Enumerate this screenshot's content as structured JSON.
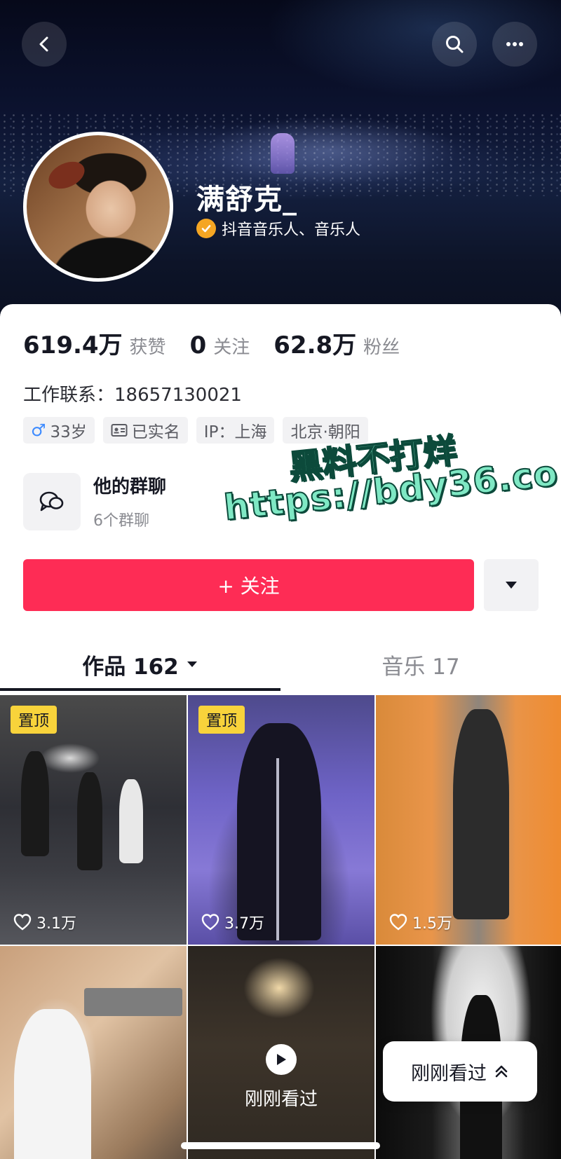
{
  "header": {
    "username": "满舒克_",
    "verification": "抖音音乐人、音乐人",
    "accent_color": "#fe2c55",
    "icons": [
      "back-icon",
      "search-icon",
      "more-icon"
    ]
  },
  "stats": [
    {
      "value": "619.4万",
      "label": "获赞"
    },
    {
      "value": "0",
      "label": "关注"
    },
    {
      "value": "62.8万",
      "label": "粉丝"
    }
  ],
  "contact": "工作联系：18657130021",
  "tags": {
    "gender_symbol": "♂",
    "age": "33岁",
    "real_name": "已实名",
    "ip": "IP：上海",
    "location": "北京·朝阳"
  },
  "group_chat": {
    "title": "他的群聊",
    "count": "6个群聊"
  },
  "watermark": {
    "line1": "黑料不打烊",
    "line2": "https://bdy36.co"
  },
  "follow_button": "+ 关注",
  "tabs": {
    "works": "作品 162",
    "music": "音乐 17"
  },
  "videos": [
    {
      "pinned": "置顶",
      "likes": "3.1万"
    },
    {
      "pinned": "置顶",
      "likes": "3.7万"
    },
    {
      "likes": "1.5万"
    },
    {},
    {
      "overlay": "刚刚看过"
    },
    {}
  ],
  "floating_button": "刚刚看过"
}
